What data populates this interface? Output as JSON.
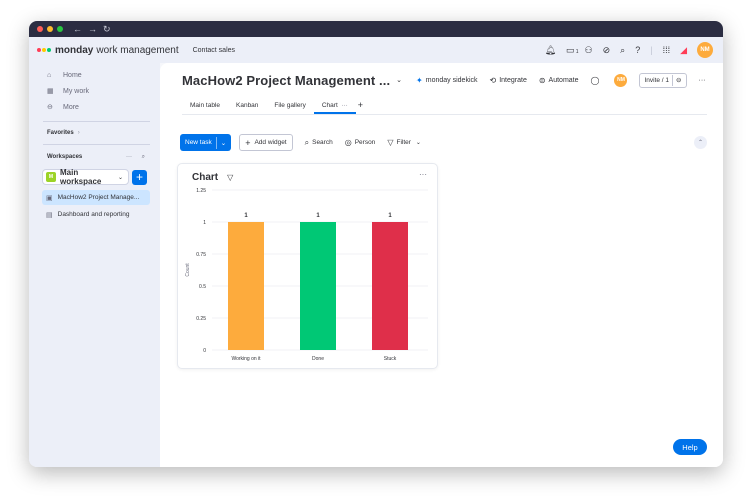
{
  "appbar": {
    "brand_name": "monday",
    "brand_sub": "work management",
    "contact_sales": "Contact sales",
    "notifications_badge": "1",
    "avatar_initials": "NM"
  },
  "sidebar": {
    "nav": [
      {
        "label": "Home",
        "icon": "home-icon"
      },
      {
        "label": "My work",
        "icon": "calendar-icon"
      },
      {
        "label": "More",
        "icon": "more-circle-icon"
      }
    ],
    "favorites_label": "Favorites",
    "favorites_chevron": "›",
    "workspaces_label": "Workspaces",
    "workspace": {
      "badge": "M",
      "name": "Main workspace"
    },
    "boards": [
      {
        "label": "MacHow2 Project Manage...",
        "active": true
      },
      {
        "label": "Dashboard and reporting",
        "active": false
      }
    ]
  },
  "board": {
    "title": "MacHow2 Project Management ...",
    "actions": {
      "sidekick": "monday sidekick",
      "integrate": "Integrate",
      "automate": "Automate",
      "invite": "Invite / 1"
    },
    "avatar_initials": "NM",
    "tabs": [
      {
        "label": "Main table",
        "active": false
      },
      {
        "label": "Kanban",
        "active": false
      },
      {
        "label": "File gallery",
        "active": false
      },
      {
        "label": "Chart",
        "active": true
      }
    ],
    "tab_more": "···",
    "tab_add": "+"
  },
  "toolbar": {
    "new_task": "New task",
    "add_widget": "Add widget",
    "search": "Search",
    "person": "Person",
    "filter": "Filter"
  },
  "widget": {
    "title": "Chart"
  },
  "chart_data": {
    "type": "bar",
    "title": "Chart",
    "categories": [
      "Working on it",
      "Done",
      "Stuck"
    ],
    "values": [
      1,
      1,
      1
    ],
    "colors": [
      "#fdab3d",
      "#00c875",
      "#df2f4a"
    ],
    "ylabel": "Count",
    "xlabel": "",
    "ylim": [
      0,
      1.25
    ],
    "yticks": [
      0,
      0.25,
      0.5,
      0.75,
      1,
      1.25
    ],
    "ytick_labels": [
      "0",
      "0.25",
      "0.5",
      "0.75",
      "1",
      "1.25"
    ],
    "grid": true
  },
  "help_label": "Help"
}
